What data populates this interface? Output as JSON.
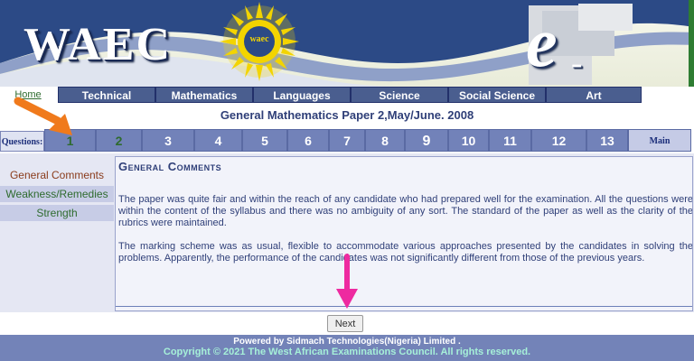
{
  "header": {
    "brand": "WAEC",
    "logo_text": "waec",
    "elearning_e": "e",
    "elearning_rest": "-learning"
  },
  "nav": [
    {
      "label": "Home"
    },
    {
      "label": "Technical"
    },
    {
      "label": "Mathematics"
    },
    {
      "label": "Languages"
    },
    {
      "label": "Science"
    },
    {
      "label": "Social Science"
    },
    {
      "label": "Art"
    }
  ],
  "page_title": "General Mathematics Paper 2,May/June. 2008",
  "questions": {
    "label": "Questions:",
    "items": [
      "1",
      "2",
      "3",
      "4",
      "5",
      "6",
      "7",
      "8",
      "9",
      "10",
      "11",
      "12",
      "13"
    ],
    "main_label": "Main"
  },
  "sidebar": {
    "items": [
      {
        "label": "General Comments"
      },
      {
        "label": "Weakness/Remedies"
      },
      {
        "label": "Strength"
      }
    ]
  },
  "content": {
    "heading": "General Comments",
    "paragraph1": "The paper was quite fair and within the reach of any candidate who had prepared well for the examination.  All the questions were within the content of the syllabus and there was no ambiguity of any sort.  The standard of the paper as well as the clarity of the rubrics were maintained.",
    "paragraph2": "The marking scheme was as usual, flexible to accommodate various approaches presented by the candidates in solving the problems. Apparently, the performance of the candidates was not significantly different from those of the previous years."
  },
  "next_label": "Next",
  "footer": {
    "powered": "Powered by Sidmach Technologies(Nigeria) Limited .",
    "copyright": "Copyright © 2021 The West African Examinations Council. All rights reserved."
  },
  "colors": {
    "nav_bg": "#4a5e8f",
    "question_bg": "#7282b9",
    "footer_bg": "#7383b8",
    "annotation_orange": "#f07a1c",
    "annotation_pink": "#ee2aa0"
  }
}
